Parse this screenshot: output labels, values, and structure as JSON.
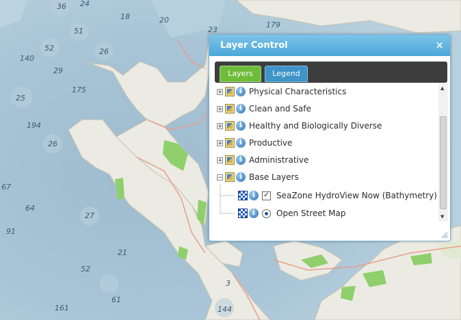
{
  "map": {
    "depth_labels": [
      "36",
      "24",
      "18",
      "20",
      "51",
      "52",
      "26",
      "140",
      "29",
      "175",
      "25",
      "194",
      "26",
      "67",
      "64",
      "27",
      "91",
      "21",
      "52",
      "161",
      "61",
      "3",
      "144",
      "23",
      "179"
    ]
  },
  "layer_control": {
    "title": "Layer Control",
    "close_symbol": "×",
    "tabs": [
      {
        "label": "Layers",
        "active": true
      },
      {
        "label": "Legend",
        "active": false
      }
    ],
    "groups": [
      {
        "label": "Physical Characteristics",
        "expanded": false
      },
      {
        "label": "Clean and Safe",
        "expanded": false
      },
      {
        "label": "Healthy and Biologically Diverse",
        "expanded": false
      },
      {
        "label": "Productive",
        "expanded": false
      },
      {
        "label": "Administrative",
        "expanded": false
      },
      {
        "label": "Base Layers",
        "expanded": true
      }
    ],
    "base_layers": [
      {
        "label": "SeaZone HydroView Now (Bathymetry)",
        "control": "checkbox",
        "checked": true
      },
      {
        "label": "Open Street Map",
        "control": "radio",
        "selected": true
      }
    ],
    "info_symbol": "i",
    "expand_symbol": "+",
    "collapse_symbol": "−",
    "check_symbol": "✓"
  }
}
